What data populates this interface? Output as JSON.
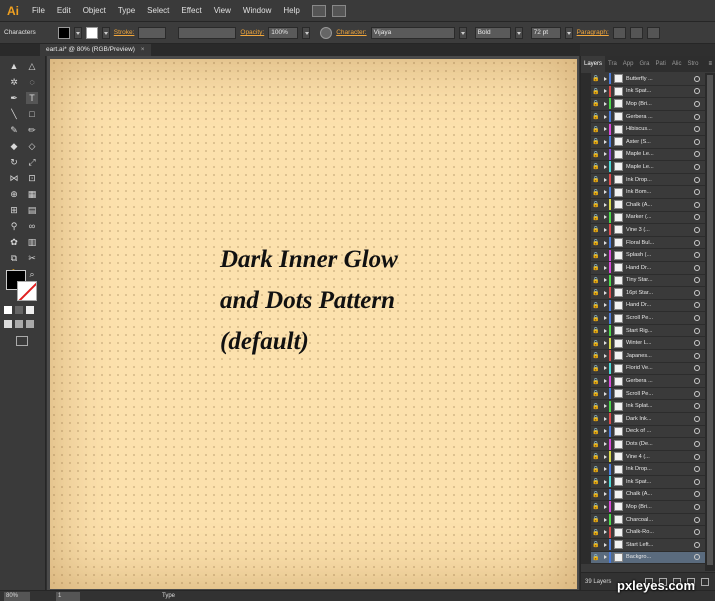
{
  "app": {
    "logo": "Ai"
  },
  "menu": [
    "File",
    "Edit",
    "Object",
    "Type",
    "Select",
    "Effect",
    "View",
    "Window",
    "Help"
  ],
  "control_bar": {
    "panel_label": "Characters",
    "stroke_label": "Stroke:",
    "opacity_label": "Opacity:",
    "opacity_value": "100%",
    "character_label": "Character:",
    "font_family": "Vijaya",
    "font_style": "Bold",
    "font_size": "72 pt",
    "paragraph_label": "Paragraph:"
  },
  "document_tab": {
    "title": "eart.ai* @ 80% (RGB/Preview)",
    "close": "×"
  },
  "artboard": {
    "text_lines": [
      "Dark Inner Glow",
      "and Dots Pattern",
      "(default)"
    ],
    "background_color": "#fce1ad",
    "dot_color": "#8c6a3c"
  },
  "layers_panel": {
    "tabs": [
      "Layers",
      "Tra",
      "App",
      "Gra",
      "Pati",
      "Alic",
      "Stro"
    ],
    "menu_icon": "≡",
    "layers": [
      {
        "name": "Butterfly ...",
        "color": "#4a7bd8"
      },
      {
        "name": "Ink Spat...",
        "color": "#d84a4a"
      },
      {
        "name": "Mop (Bri...",
        "color": "#4ad84a"
      },
      {
        "name": "Gerbera ...",
        "color": "#4a7bd8"
      },
      {
        "name": "Hibiscus...",
        "color": "#d84ad8"
      },
      {
        "name": "Aster (S...",
        "color": "#4a7bd8"
      },
      {
        "name": "Maple Le...",
        "color": "#8a4ad8"
      },
      {
        "name": "Maple Le...",
        "color": "#4ad8d8"
      },
      {
        "name": "Ink Drop...",
        "color": "#d84a4a"
      },
      {
        "name": "Ink Bom...",
        "color": "#4a7bd8"
      },
      {
        "name": "Chalk (A...",
        "color": "#d8d84a"
      },
      {
        "name": "Marker (...",
        "color": "#4ad84a"
      },
      {
        "name": "Vine 3 (...",
        "color": "#d84a4a"
      },
      {
        "name": "Floral Bul...",
        "color": "#4a7bd8"
      },
      {
        "name": "Splash (...",
        "color": "#d84ad8"
      },
      {
        "name": "Hand Dr...",
        "color": "#d84ad8"
      },
      {
        "name": "Tiny Star...",
        "color": "#4ad84a"
      },
      {
        "name": "16pt Star...",
        "color": "#d84a4a"
      },
      {
        "name": "Hand Dr...",
        "color": "#4a7bd8"
      },
      {
        "name": "Scroll Pe...",
        "color": "#4a7bd8"
      },
      {
        "name": "Start Rig...",
        "color": "#4ad84a"
      },
      {
        "name": "Winter L...",
        "color": "#d8d84a"
      },
      {
        "name": "Japanes...",
        "color": "#d84a4a"
      },
      {
        "name": "Florid Ve...",
        "color": "#4ad8d8"
      },
      {
        "name": "Gerbera ...",
        "color": "#d84ad8"
      },
      {
        "name": "Scroll Pe...",
        "color": "#4a7bd8"
      },
      {
        "name": "Ink Splat...",
        "color": "#4ad84a"
      },
      {
        "name": "Dark Ink...",
        "color": "#d84a4a"
      },
      {
        "name": "Deck of ...",
        "color": "#4a7bd8"
      },
      {
        "name": "Dots (De...",
        "color": "#d84ad8"
      },
      {
        "name": "Vine 4 (...",
        "color": "#d8d84a"
      },
      {
        "name": "Ink Drop...",
        "color": "#4a7bd8"
      },
      {
        "name": "Ink Spat...",
        "color": "#4ad8d8"
      },
      {
        "name": "Chalk (A...",
        "color": "#4a7bd8"
      },
      {
        "name": "Mop (Bri...",
        "color": "#d84ad8"
      },
      {
        "name": "Charcoal...",
        "color": "#4ad84a"
      },
      {
        "name": "Chalk-Ro...",
        "color": "#d84a4a"
      },
      {
        "name": "Start Left...",
        "color": "#4a7bd8"
      },
      {
        "name": "Backgro...",
        "color": "#4a7bd8"
      }
    ],
    "layer_count": "39 Layers"
  },
  "status_bar": {
    "zoom": "80%",
    "page": "1",
    "tool": "Type"
  },
  "watermark": "pxleyes.com"
}
